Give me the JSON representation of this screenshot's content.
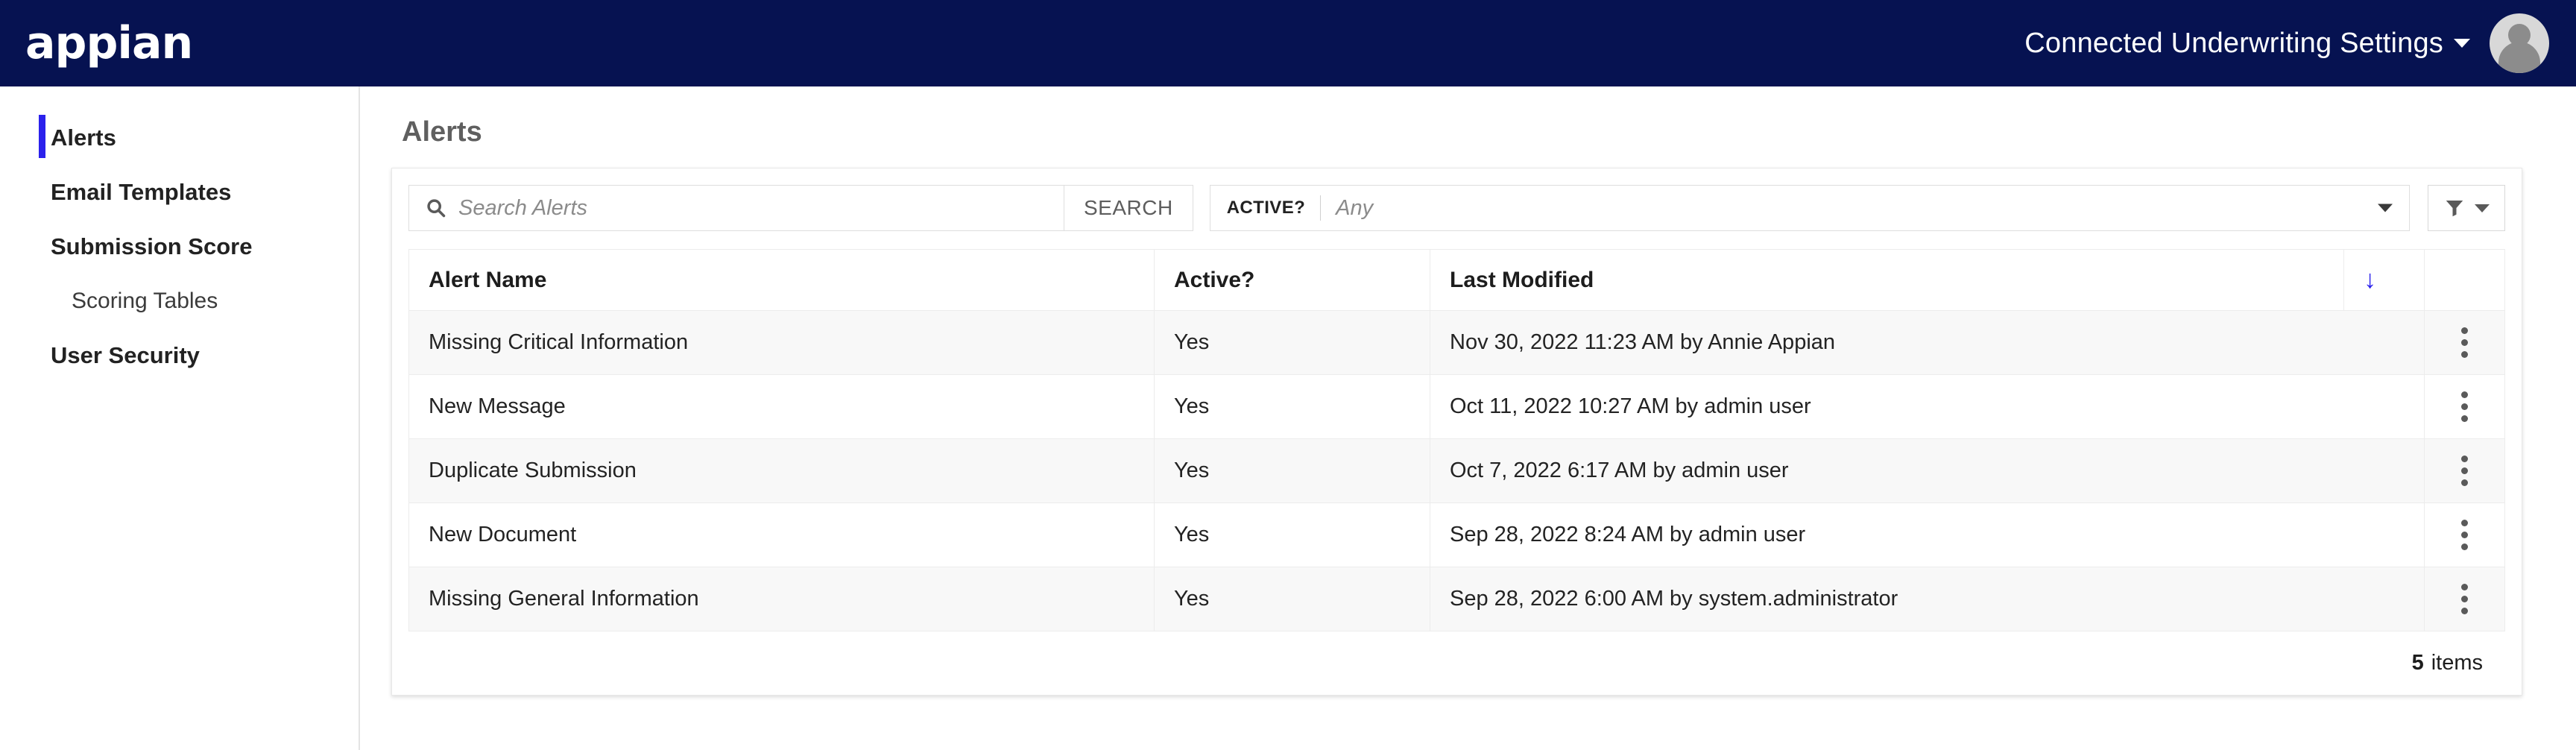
{
  "theme": {
    "header_bg": "#061251",
    "accent_blue": "#2b21ec",
    "row_alt_bg": "#f8f8f8",
    "border": "#ececec"
  },
  "header": {
    "logo_text": "appian",
    "site_title": "Connected Underwriting Settings",
    "site_title_caret_icon": "chevron-down-icon",
    "avatar_icon": "user-avatar-icon"
  },
  "sidebar": {
    "items": [
      {
        "label": "Alerts",
        "active": true,
        "sub": false
      },
      {
        "label": "Email Templates",
        "active": false,
        "sub": false
      },
      {
        "label": "Submission Score",
        "active": false,
        "sub": false
      },
      {
        "label": "Scoring Tables",
        "active": false,
        "sub": true
      },
      {
        "label": "User Security",
        "active": false,
        "sub": false
      }
    ]
  },
  "main": {
    "page_title": "Alerts",
    "search": {
      "icon": "search-icon",
      "placeholder": "Search Alerts",
      "value": "",
      "button_label": "SEARCH"
    },
    "active_filter": {
      "label": "ACTIVE?",
      "value": "Any",
      "caret_icon": "chevron-down-icon"
    },
    "filter_button": {
      "icon": "funnel-icon",
      "caret_icon": "chevron-down-icon"
    },
    "grid": {
      "columns": [
        "Alert Name",
        "Active?",
        "Last Modified"
      ],
      "sort": {
        "column": "Last Modified",
        "direction": "descending",
        "icon": "arrow-down-icon"
      },
      "rows": [
        {
          "name": "Missing Critical Information",
          "active": "Yes",
          "last_modified": "Nov 30, 2022 11:23 AM by Annie Appian",
          "menu_icon": "kebab-menu-icon"
        },
        {
          "name": "New Message",
          "active": "Yes",
          "last_modified": "Oct 11, 2022 10:27 AM by admin user",
          "menu_icon": "kebab-menu-icon"
        },
        {
          "name": "Duplicate Submission",
          "active": "Yes",
          "last_modified": "Oct 7, 2022 6:17 AM by admin user",
          "menu_icon": "kebab-menu-icon"
        },
        {
          "name": "New Document",
          "active": "Yes",
          "last_modified": "Sep 28, 2022 8:24 AM by admin user",
          "menu_icon": "kebab-menu-icon"
        },
        {
          "name": "Missing General Information",
          "active": "Yes",
          "last_modified": "Sep 28, 2022 6:00 AM by system.administrator",
          "menu_icon": "kebab-menu-icon"
        }
      ],
      "footer": {
        "count": "5",
        "count_label": "items"
      }
    }
  }
}
